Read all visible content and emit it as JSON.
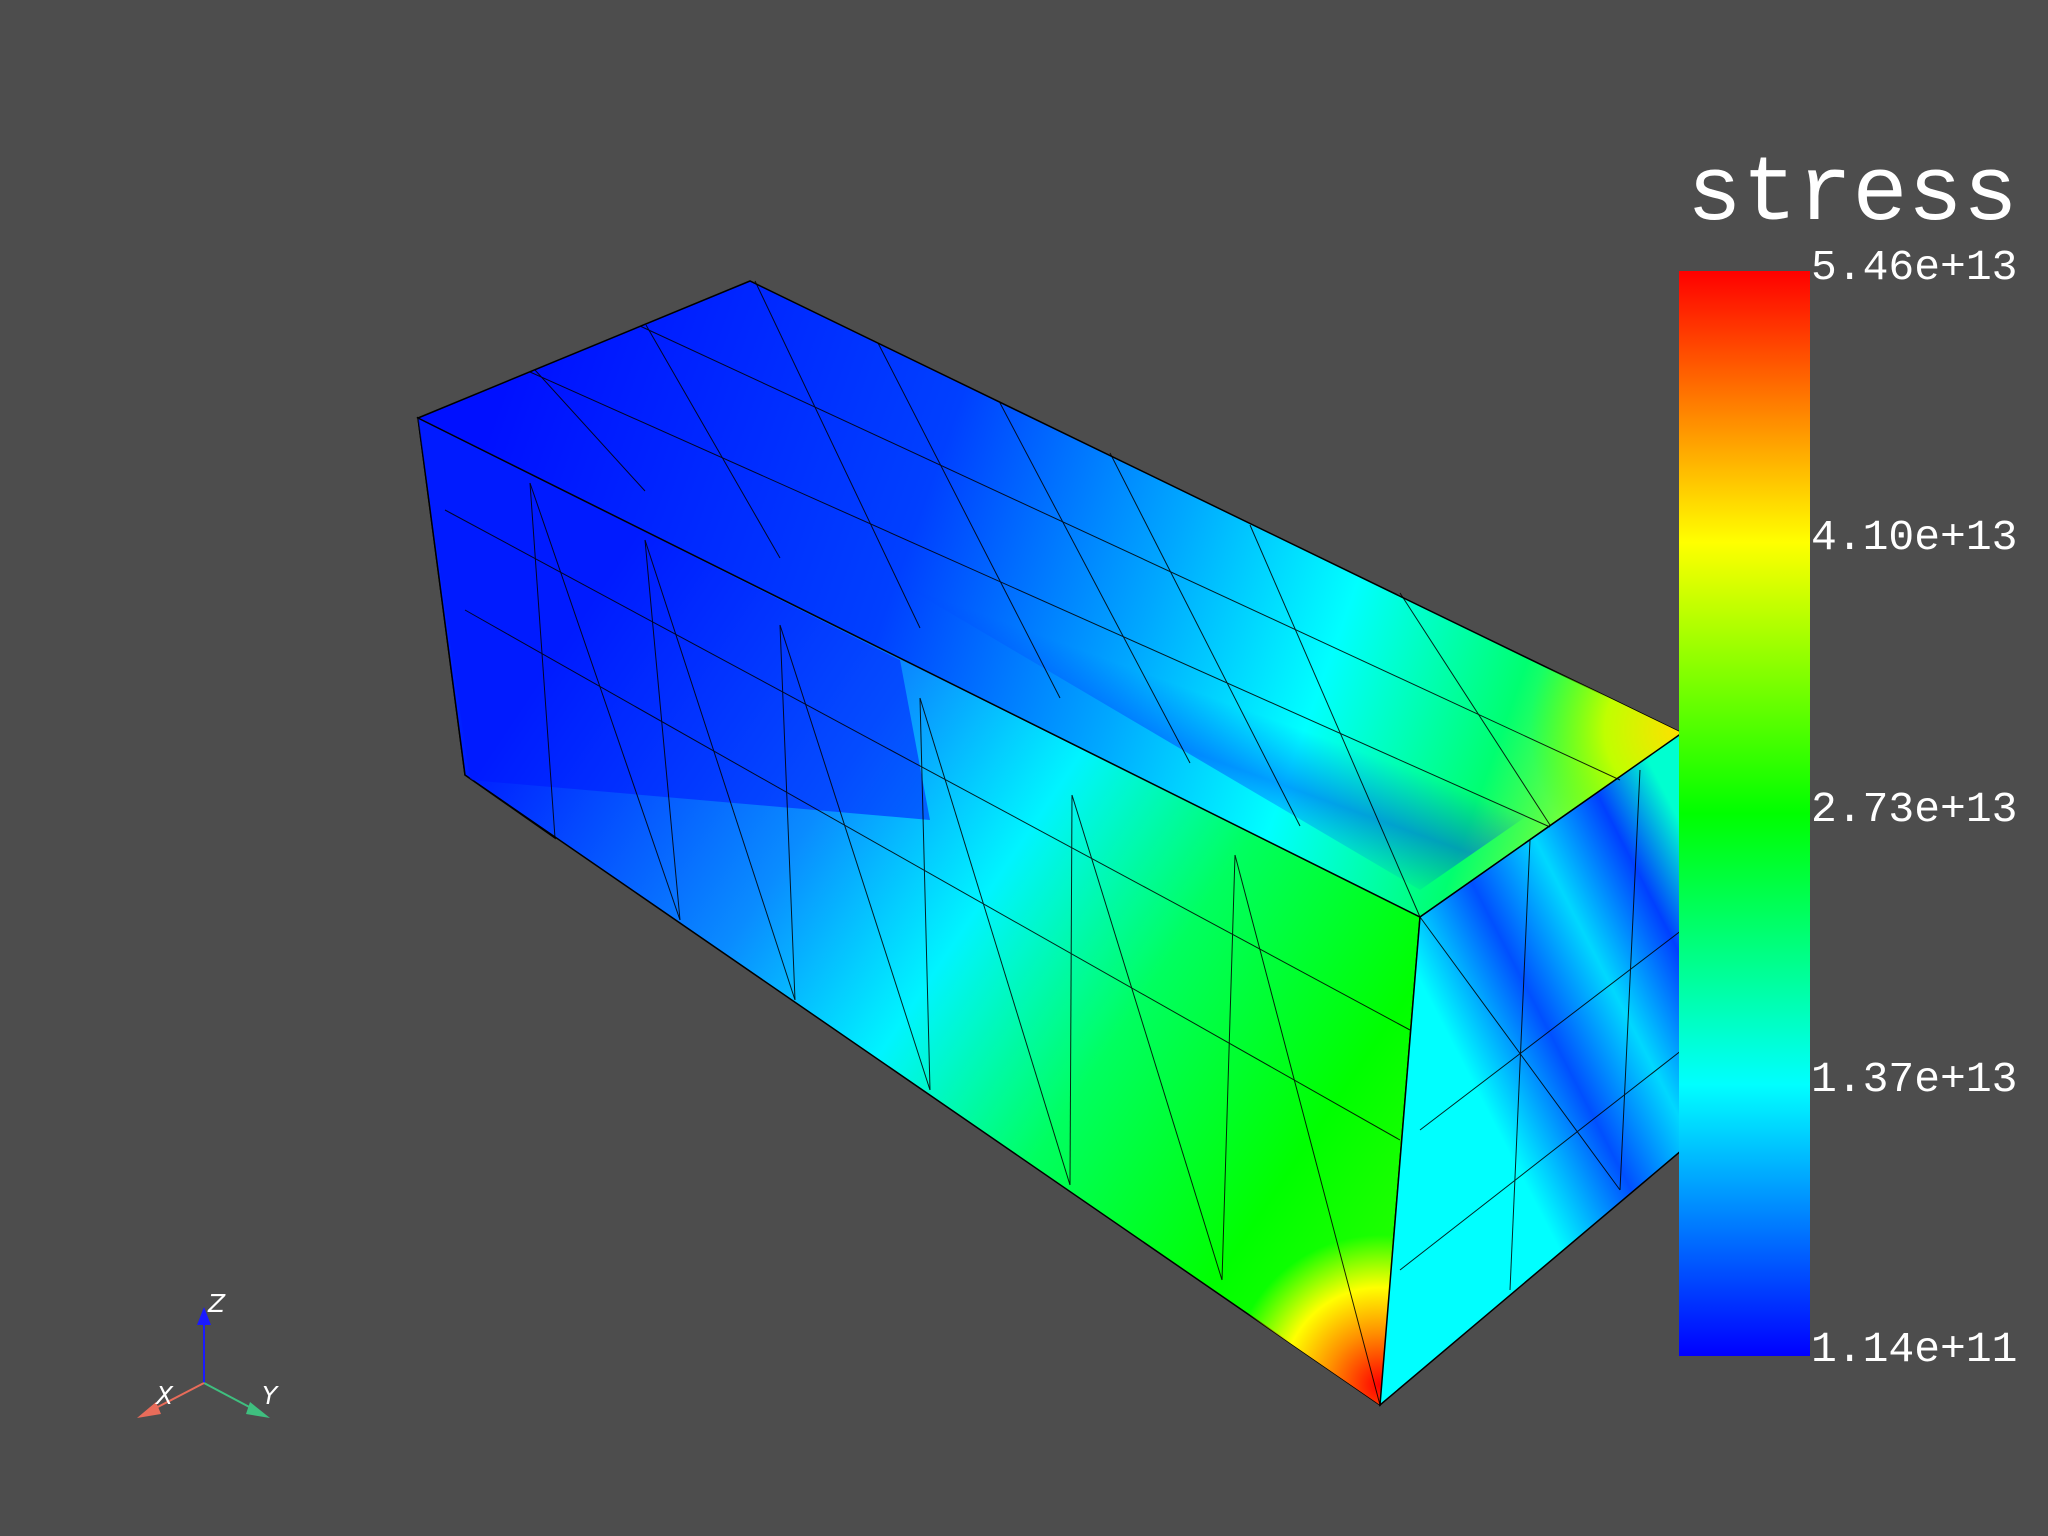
{
  "scalar_bar": {
    "title": "stress",
    "labels": [
      "5.46e+13",
      "4.10e+13",
      "2.73e+13",
      "1.37e+13",
      "1.14e+11"
    ],
    "colors": {
      "top": "#ff0000",
      "upper": "#ffff00",
      "middle": "#00ff00",
      "lower": "#00ffff",
      "bottom": "#0000ff"
    }
  },
  "orientation_axes": {
    "x_label": "X",
    "y_label": "Y",
    "z_label": "Z",
    "x_color": "#e86c5a",
    "y_color": "#3fbf7f",
    "z_color": "#1a1aff"
  },
  "background_color": "#4d4d4d"
}
